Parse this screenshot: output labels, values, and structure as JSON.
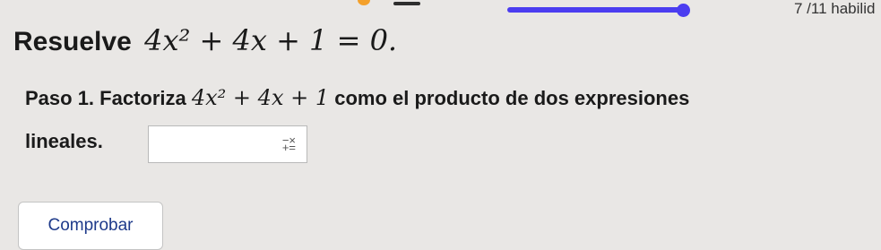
{
  "header": {
    "counter_text": "7 /11 habilid",
    "progress_fraction": 0.98,
    "colors": {
      "accent": "#4b3df0",
      "orange": "#f4a02a"
    }
  },
  "question": {
    "label": "Resuelve",
    "expression": "4x² + 4x + 1 = 0."
  },
  "step": {
    "prefix": "Paso 1. Factoriza",
    "expression": "4x² + 4x + 1",
    "suffix": "como el producto de dos expresiones",
    "line2": "lineales."
  },
  "answer": {
    "value": "",
    "icon": "math-keyboard-icon"
  },
  "actions": {
    "check_label": "Comprobar"
  }
}
